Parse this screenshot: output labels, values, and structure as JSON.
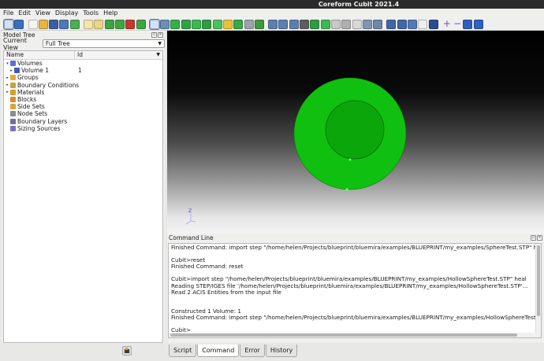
{
  "window": {
    "title": "Coreform Cubit 2021.4"
  },
  "menu": [
    "File",
    "Edit",
    "View",
    "Display",
    "Tools",
    "Help"
  ],
  "toolbar": {
    "groups": [
      [
        {
          "icon": "select-arrow-icon",
          "color": "#dfe6ef",
          "selected": true
        },
        {
          "icon": "rotate-icon",
          "color": "#3a6fc0"
        }
      ],
      [
        {
          "icon": "new-file-icon",
          "color": "#f4f4f4"
        },
        {
          "icon": "open-folder-icon",
          "color": "#e7b640"
        },
        {
          "icon": "save-icon",
          "color": "#3c5fa0"
        },
        {
          "icon": "save-as-icon",
          "color": "#5078b8"
        },
        {
          "icon": "check-icon",
          "color": "#4caf50"
        }
      ],
      [
        {
          "icon": "edit-file-icon",
          "color": "#f3e6a8"
        },
        {
          "icon": "journal-icon",
          "color": "#e9d48a"
        },
        {
          "icon": "play-icon",
          "color": "#3fa441"
        },
        {
          "icon": "pause-icon",
          "color": "#3fa441"
        },
        {
          "icon": "record-icon",
          "color": "#c7372f"
        },
        {
          "icon": "step-icon",
          "color": "#3fa441"
        }
      ],
      [
        {
          "icon": "grid-select-icon",
          "color": "#8aa0c0",
          "selected": true
        },
        {
          "icon": "cube-select-icon",
          "color": "#6a8fb8"
        },
        {
          "icon": "cube-green-icon",
          "color": "#36b14a"
        },
        {
          "icon": "cube-green-2-icon",
          "color": "#2fa344"
        },
        {
          "icon": "cube-green-3-icon",
          "color": "#3cb850"
        },
        {
          "icon": "cube-green-4-icon",
          "color": "#2e9d40"
        },
        {
          "icon": "cube-green-5-icon",
          "color": "#4cc05a"
        },
        {
          "icon": "cube-yellow-icon",
          "color": "#e8c23a"
        },
        {
          "icon": "cube-green-6-icon",
          "color": "#37a947"
        },
        {
          "icon": "cube-grey-icon",
          "color": "#9aa3ad"
        },
        {
          "icon": "refresh-icon",
          "color": "#3e9a3e"
        }
      ],
      [
        {
          "icon": "zoom-in-icon",
          "color": "#5d7fb0"
        },
        {
          "icon": "zoom-out-icon",
          "color": "#5d7fb0"
        },
        {
          "icon": "zoom-fit-icon",
          "color": "#5d7fb0"
        },
        {
          "icon": "shaded-box-icon",
          "color": "#5e5e5e"
        },
        {
          "icon": "green-box-icon",
          "color": "#2e9d40"
        },
        {
          "icon": "green-box-2-icon",
          "color": "#3cb850"
        },
        {
          "icon": "wire-box-icon",
          "color": "#c8c8c8"
        },
        {
          "icon": "hidden-line-icon",
          "color": "#b0b0b0"
        },
        {
          "icon": "transparent-box-icon",
          "color": "#d8d8d8"
        },
        {
          "icon": "box-view-icon",
          "color": "#7f95b5"
        },
        {
          "icon": "box-view-2-icon",
          "color": "#6f86a8"
        }
      ],
      [
        {
          "icon": "top-view-icon",
          "color": "#3f67a8"
        },
        {
          "icon": "front-view-icon",
          "color": "#3f67a8"
        },
        {
          "icon": "iso-view-icon",
          "color": "#5378b6"
        },
        {
          "icon": "curve-icon",
          "color": "#eeeeee"
        },
        {
          "icon": "point-icon",
          "color": "#2a4c8c"
        }
      ],
      [
        {
          "icon": "add-icon",
          "glyph": "+"
        },
        {
          "icon": "remove-icon",
          "glyph": "−"
        },
        {
          "icon": "blue-box-icon",
          "color": "#2f5fbf"
        },
        {
          "icon": "blue-box-2-icon",
          "color": "#2f5fbf"
        }
      ]
    ]
  },
  "model_tree": {
    "title": "Model Tree",
    "current_view_label": "Current View",
    "current_view_value": "Full Tree",
    "columns": {
      "name": "Name",
      "id": "Id"
    },
    "rows": [
      {
        "label": "Volumes",
        "expander": "▾",
        "indent": 0,
        "icon": "volumes-icon",
        "color": "#5a6fd0",
        "id": ""
      },
      {
        "label": "Volume 1",
        "expander": "▸",
        "indent": 1,
        "icon": "volume-icon",
        "color": "#4557b8",
        "id": "1"
      },
      {
        "label": "Groups",
        "expander": "▸",
        "indent": 0,
        "icon": "groups-icon",
        "color": "#e0a93a",
        "id": ""
      },
      {
        "label": "Boundary Conditions",
        "expander": "▸",
        "indent": 0,
        "icon": "boundary-conditions-icon",
        "color": "#c9a13a",
        "id": ""
      },
      {
        "label": "Materials",
        "expander": "▸",
        "indent": 0,
        "icon": "materials-icon",
        "color": "#d49b36",
        "id": ""
      },
      {
        "label": "Blocks",
        "expander": "",
        "indent": 0,
        "icon": "blocks-icon",
        "color": "#d98d2e",
        "id": ""
      },
      {
        "label": "Side Sets",
        "expander": "",
        "indent": 0,
        "icon": "side-sets-icon",
        "color": "#d7a540",
        "id": ""
      },
      {
        "label": "Node Sets",
        "expander": "",
        "indent": 0,
        "icon": "node-sets-icon",
        "color": "#8a8a8a",
        "id": ""
      },
      {
        "label": "Boundary Layers",
        "expander": "",
        "indent": 0,
        "icon": "boundary-layers-icon",
        "color": "#6f6f9f",
        "id": ""
      },
      {
        "label": "Sizing Sources",
        "expander": "",
        "indent": 0,
        "icon": "sizing-sources-icon",
        "color": "#7b6fc4",
        "id": ""
      }
    ]
  },
  "viewport": {
    "axis_z": "Z",
    "sphere_color": "#0bbf0b",
    "inner_color": "#0a9e0a"
  },
  "command_line": {
    "title": "Command Line",
    "lines": [
      "Finished Command: import step \"/home/helen/Projects/blueprint/bluemira/examples/BLUEPRINT/my_examples/SphereTest.STP\" heal",
      "",
      "Cubit>reset",
      "Finished Command: reset",
      "",
      "Cubit>import step \"/home/helen/Projects/blueprint/bluemira/examples/BLUEPRINT/my_examples/HollowSphereTest.STP\" heal",
      "Reading STEP/IGES file '/home/helen/Projects/blueprint/bluemira/examples/BLUEPRINT/my_examples/HollowSphereTest.STP'...",
      "Read 2 ACIS Entities from the input file",
      "",
      "",
      "Constructed 1 Volume: 1",
      "Finished Command: import step \"/home/helen/Projects/blueprint/bluemira/examples/BLUEPRINT/my_examples/HollowSphereTest.STP\"",
      "",
      "Cubit>"
    ]
  },
  "tabs": [
    {
      "label": "Script",
      "active": false
    },
    {
      "label": "Command",
      "active": true
    },
    {
      "label": "Error",
      "active": false
    },
    {
      "label": "History",
      "active": false
    }
  ]
}
